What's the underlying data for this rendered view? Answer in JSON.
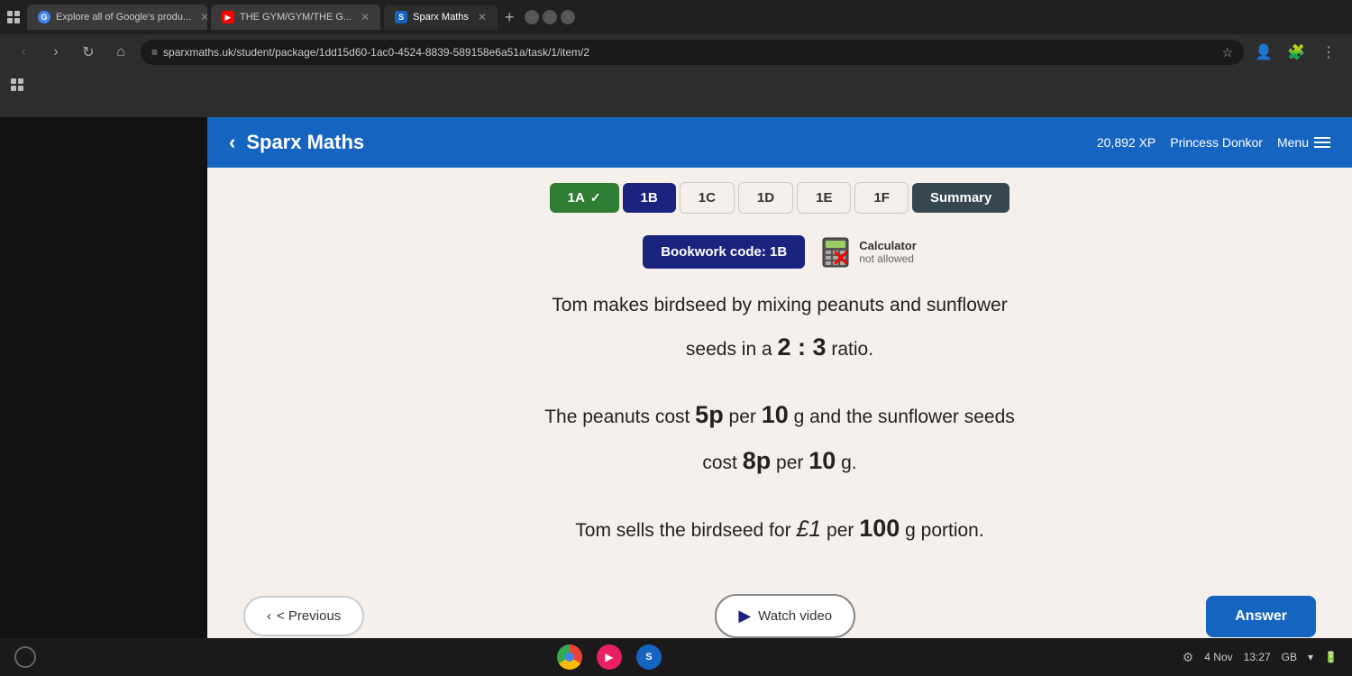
{
  "browser": {
    "tabs": [
      {
        "id": "tab1",
        "label": "Explore all of Google's produ...",
        "favicon": "G",
        "active": false
      },
      {
        "id": "tab2",
        "label": "THE GYM/GYM/THE G...",
        "favicon": "▶",
        "active": false
      },
      {
        "id": "tab3",
        "label": "Sparx Maths",
        "favicon": "S",
        "active": true
      }
    ],
    "address": "sparxmaths.uk/student/package/1dd15d60-1ac0-4524-8839-589158e6a51a/task/1/item/2",
    "windowControls": {
      "min": "—",
      "max": "□",
      "close": "✕"
    }
  },
  "header": {
    "back_label": "‹",
    "title": "Sparx Maths",
    "xp": "20,892 XP",
    "user": "Princess Donkor",
    "menu_label": "Menu"
  },
  "tabs": [
    {
      "id": "1A",
      "label": "1A",
      "state": "completed"
    },
    {
      "id": "1B",
      "label": "1B",
      "state": "active"
    },
    {
      "id": "1C",
      "label": "1C",
      "state": "inactive"
    },
    {
      "id": "1D",
      "label": "1D",
      "state": "inactive"
    },
    {
      "id": "1E",
      "label": "1E",
      "state": "inactive"
    },
    {
      "id": "1F",
      "label": "1F",
      "state": "inactive"
    },
    {
      "id": "summary",
      "label": "Summary",
      "state": "summary"
    }
  ],
  "question": {
    "bookwork_code": "Bookwork code: 1B",
    "calculator_label": "Calculator",
    "calculator_status": "not allowed",
    "line1": "Tom makes birdseed by mixing peanuts and sunflower",
    "line2": "seeds in a",
    "ratio": "2 : 3",
    "line2end": "ratio.",
    "line3": "The peanuts cost",
    "cost1_num": "5p",
    "cost1_per": "per",
    "cost1_unit": "10",
    "cost1_unit_label": "g and the sunflower seeds",
    "line4": "cost",
    "cost2_num": "8p",
    "cost2_per": "per",
    "cost2_unit": "10",
    "cost2_unit_label": "g.",
    "line5": "Tom sells the birdseed for",
    "sell_price": "£1",
    "sell_per": "per",
    "sell_unit": "100",
    "sell_unit_label": "g portion."
  },
  "buttons": {
    "previous": "< Previous",
    "watch_video": "Watch video",
    "answer": "Answer"
  },
  "taskbar": {
    "date": "4 Nov",
    "time": "13:27",
    "network": "GB"
  }
}
